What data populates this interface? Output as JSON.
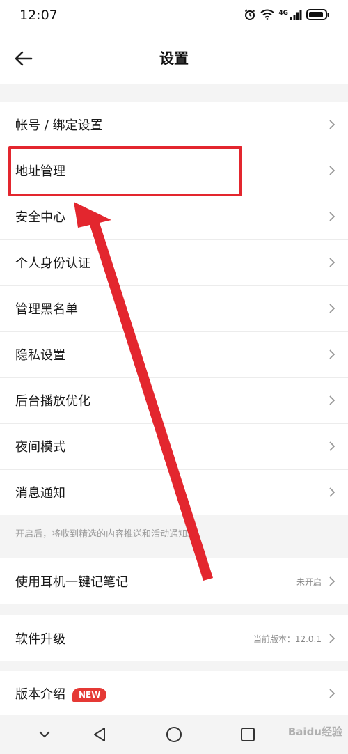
{
  "status_bar": {
    "time": "12:07",
    "network_label": "4G",
    "icons": [
      "alarm-icon",
      "wifi-icon",
      "signal-icon",
      "battery-icon"
    ]
  },
  "header": {
    "title": "设置",
    "back_icon": "arrow-left-icon"
  },
  "groups": {
    "main": {
      "items": [
        {
          "label": "帐号 / 绑定设置"
        },
        {
          "label": "地址管理"
        },
        {
          "label": "安全中心"
        },
        {
          "label": "个人身份认证"
        },
        {
          "label": "管理黑名单"
        },
        {
          "label": "隐私设置"
        },
        {
          "label": "后台播放优化"
        },
        {
          "label": "夜间模式"
        },
        {
          "label": "消息通知"
        }
      ],
      "note": "开启后，将收到精选的内容推送和活动通知。"
    },
    "earphone": {
      "label": "使用耳机一键记笔记",
      "value": "未开启"
    },
    "upgrade": {
      "label": "软件升级",
      "value": "当前版本：12.0.1"
    },
    "about": {
      "label": "版本介绍",
      "badge": "NEW"
    }
  },
  "annotation": {
    "highlight_color": "#e3262e"
  },
  "nav_bar": {
    "icons": [
      "chevron-down-icon",
      "back-triangle-icon",
      "home-circle-icon",
      "recents-square-icon"
    ]
  },
  "watermark": "Baidu经验",
  "colors": {
    "background": "#f4f4f4",
    "surface": "#ffffff",
    "badge": "#e53935",
    "annotation": "#e3262e"
  }
}
